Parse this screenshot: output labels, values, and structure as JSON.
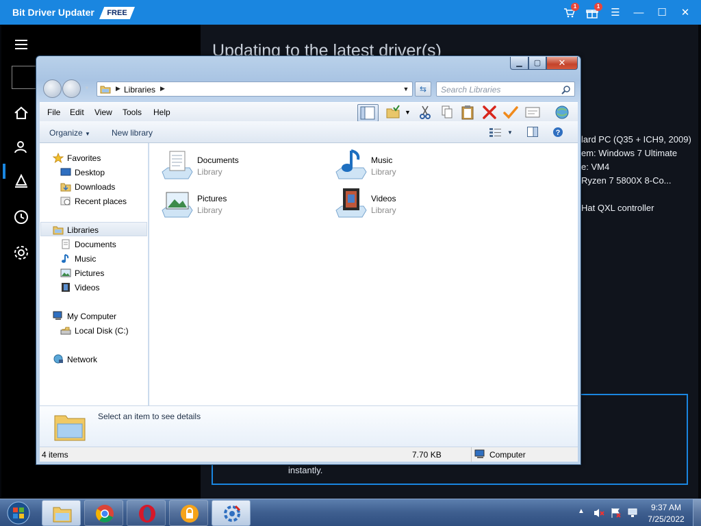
{
  "bdu": {
    "title": "Bit Driver Updater",
    "badge": "FREE",
    "cart_count": "1",
    "gift_count": "1",
    "heading": "Updating to the latest driver(s)",
    "system_info": [
      "lard PC (Q35 + ICH9, 2009)",
      "em: Windows 7 Ultimate",
      "e: VM4",
      "Ryzen 7 5800X 8-Co...",
      "Hat QXL controller"
    ],
    "box_text": "instantly."
  },
  "explorer": {
    "address": "Libraries",
    "search_placeholder": "Search Libraries",
    "menu": [
      "File",
      "Edit",
      "View",
      "Tools",
      "Help"
    ],
    "commands": {
      "organize": "Organize",
      "new_library": "New library"
    },
    "nav": {
      "favorites": "Favorites",
      "desktop": "Desktop",
      "downloads": "Downloads",
      "recent_places": "Recent places",
      "libraries": "Libraries",
      "documents": "Documents",
      "music": "Music",
      "pictures": "Pictures",
      "videos": "Videos",
      "my_computer": "My Computer",
      "local_disk": "Local Disk (C:)",
      "network": "Network"
    },
    "libraries": [
      {
        "name": "Documents",
        "type": "Library",
        "icon": "documents-library-icon"
      },
      {
        "name": "Music",
        "type": "Library",
        "icon": "music-library-icon"
      },
      {
        "name": "Pictures",
        "type": "Library",
        "icon": "pictures-library-icon"
      },
      {
        "name": "Videos",
        "type": "Library",
        "icon": "videos-library-icon"
      }
    ],
    "details_text": "Select an item to see details",
    "status": {
      "items": "4 items",
      "size": "7.70 KB",
      "location": "Computer"
    }
  },
  "taskbar": {
    "apps": [
      "explorer-icon",
      "chrome-icon",
      "opera-icon",
      "vpn-lock-icon",
      "bit-driver-updater-icon"
    ],
    "time": "9:37 AM",
    "date": "7/25/2022"
  },
  "colors": {
    "bdu_blue": "#1a86e0",
    "close_red": "#c4432b",
    "taskbar": "#3e5e8f"
  }
}
